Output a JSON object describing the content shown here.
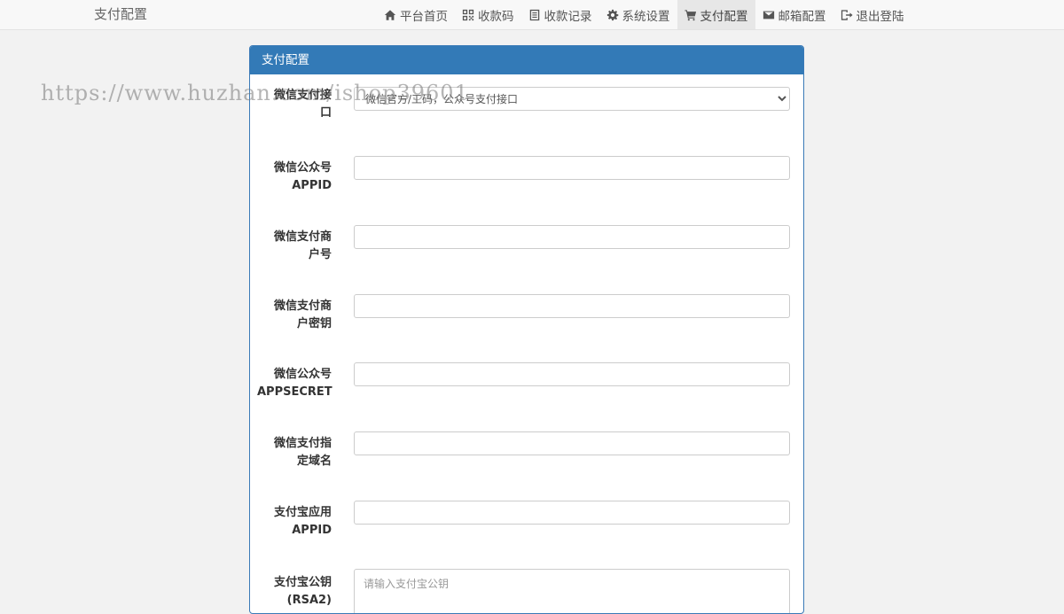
{
  "brand": "支付配置",
  "nav": {
    "items": [
      {
        "label": "平台首页",
        "icon": "home-icon"
      },
      {
        "label": "收款码",
        "icon": "qrcode-icon"
      },
      {
        "label": "收款记录",
        "icon": "list-icon"
      },
      {
        "label": "系统设置",
        "icon": "gear-icon"
      },
      {
        "label": "支付配置",
        "icon": "cart-icon",
        "active": true
      },
      {
        "label": "邮箱配置",
        "icon": "envelope-icon"
      },
      {
        "label": "退出登陆",
        "icon": "logout-icon"
      }
    ]
  },
  "panel": {
    "title": "支付配置",
    "fields": [
      {
        "label_l1": "微信支付接",
        "label_l2": "口",
        "type": "select",
        "value": "微信官方/工码，公众号支付接口"
      },
      {
        "label_l1": "微信公众号",
        "label_l2": "APPID",
        "type": "input",
        "value": ""
      },
      {
        "label_l1": "微信支付商",
        "label_l2": "户号",
        "type": "input",
        "value": ""
      },
      {
        "label_l1": "微信支付商",
        "label_l2": "户密钥",
        "type": "input",
        "value": ""
      },
      {
        "label_l1": "微信公众号",
        "label_l2": "APPSECRET",
        "type": "input",
        "value": ""
      },
      {
        "label_l1": "微信支付指",
        "label_l2": "定域名",
        "type": "input",
        "value": ""
      },
      {
        "label_l1": "支付宝应用",
        "label_l2": "APPID",
        "type": "input",
        "value": ""
      },
      {
        "label_l1": "支付宝公钥",
        "label_l2": "(RSA2)",
        "type": "textarea",
        "placeholder": "请输入支付宝公钥"
      }
    ]
  },
  "watermark": "https://www.huzhan.com/ishop39601"
}
